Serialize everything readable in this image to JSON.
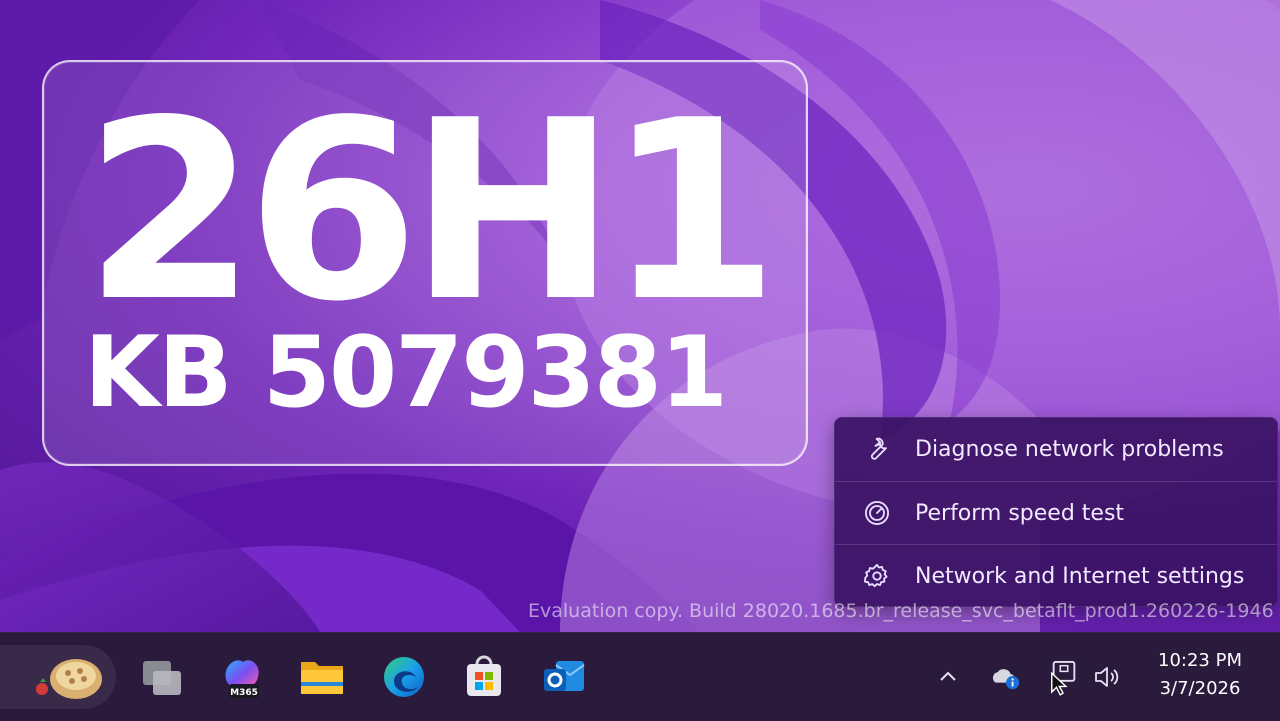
{
  "hero": {
    "title": "26H1",
    "subtitle": "KB 5079381"
  },
  "context_menu": {
    "items": [
      {
        "label": "Diagnose network problems",
        "icon": "wrench-icon"
      },
      {
        "label": "Perform speed test",
        "icon": "speedometer-icon"
      },
      {
        "label": "Network and Internet settings",
        "icon": "gear-icon"
      }
    ]
  },
  "watermark": "Evaluation copy. Build 28020.1685.br_release_svc_betaflt_prod1.260226-1946",
  "taskbar": {
    "apps": [
      {
        "name": "task-view",
        "icon": "task-view-icon"
      },
      {
        "name": "m365-copilot",
        "icon": "m365-icon",
        "badge": "M365"
      },
      {
        "name": "file-explorer",
        "icon": "folder-icon"
      },
      {
        "name": "edge",
        "icon": "edge-icon"
      },
      {
        "name": "microsoft-store",
        "icon": "store-icon"
      },
      {
        "name": "outlook",
        "icon": "outlook-icon"
      }
    ],
    "clock": {
      "time": "10:23 PM",
      "date": "3/7/2026"
    }
  },
  "colors": {
    "accent": "#8e3fd1",
    "menu_bg": "#3a1264",
    "taskbar_bg": "#2a1a3c"
  }
}
